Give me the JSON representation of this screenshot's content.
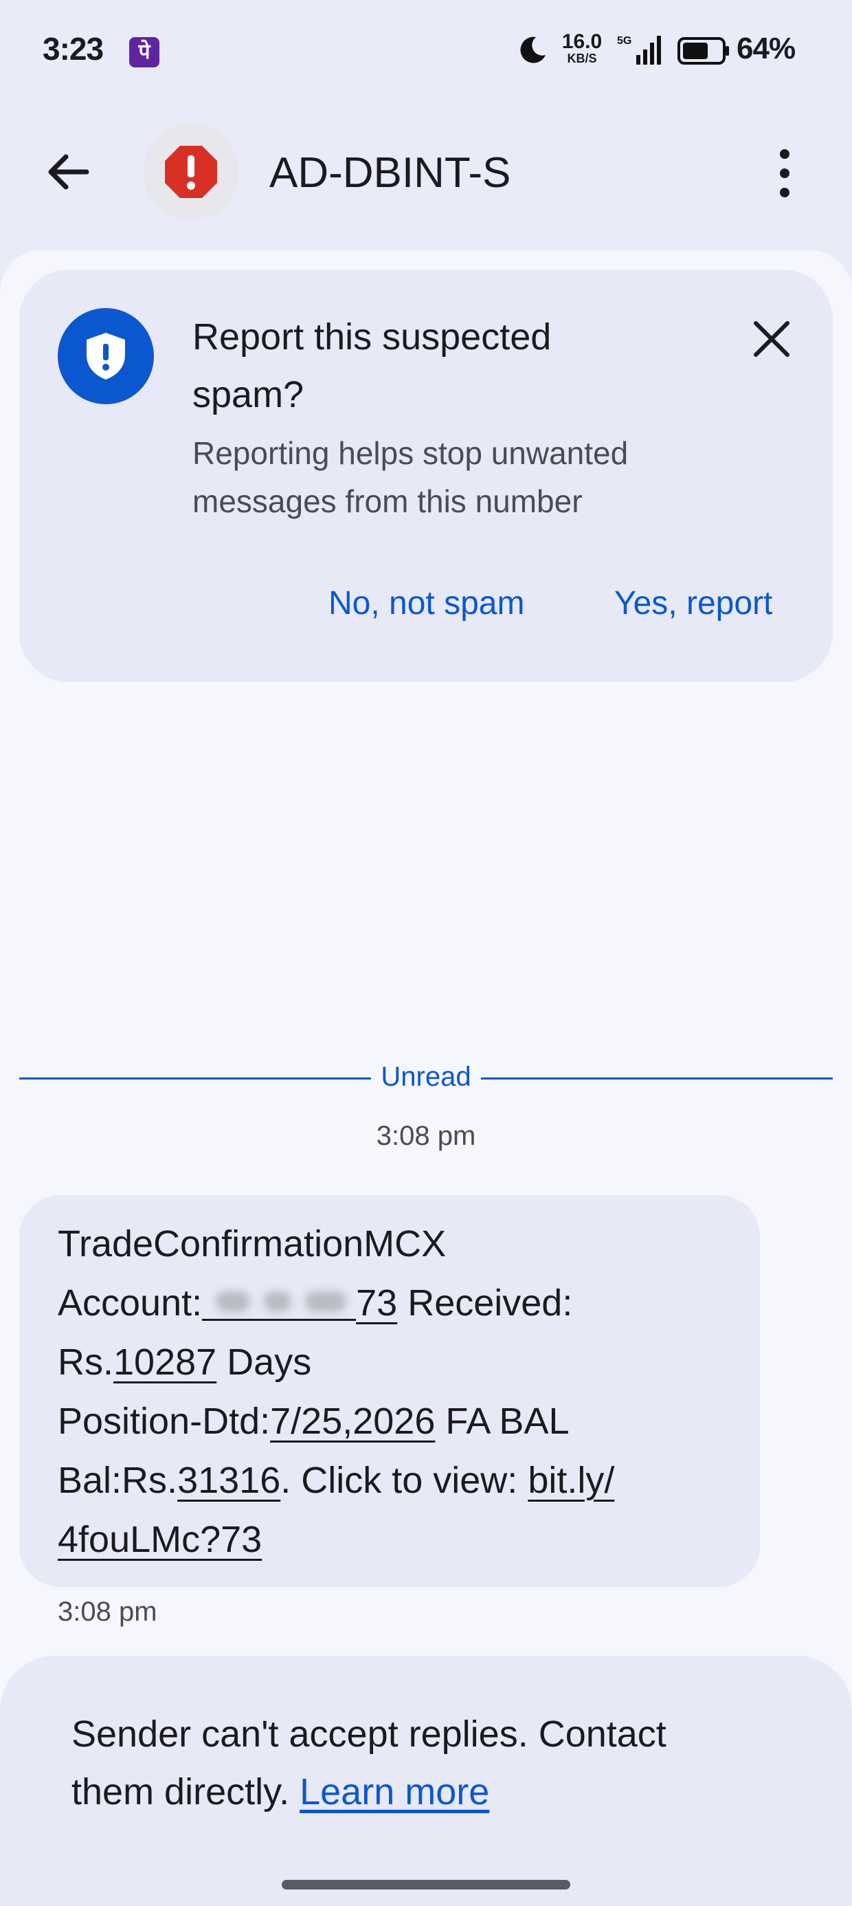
{
  "status_bar": {
    "time": "3:23",
    "app_badge": "पे",
    "net_speed_value": "16.0",
    "net_speed_unit": "KB/S",
    "network_label": "5G",
    "battery": "64%"
  },
  "app_bar": {
    "title": "AD-DBINT-S",
    "avatar_icon": "spam-warning-icon",
    "back_icon": "arrow-back-icon",
    "menu_icon": "more-vert-icon"
  },
  "spam_card": {
    "title": "Report this suspected spam?",
    "body": "Reporting helps stop unwanted messages from this number",
    "no_button": "No, not spam",
    "yes_button": "Yes, report",
    "icon": "shield-alert-icon",
    "close_icon": "close-icon"
  },
  "thread": {
    "unread_label": "Unread",
    "date_time": "3:08 pm",
    "message": {
      "line1": "TradeConfirmationMCX",
      "account_prefix": "Account:",
      "account_suffix": "73",
      "received": " Received:",
      "rs_prefix": "Rs.",
      "amount": "10287",
      "days": " Days",
      "position_prefix": "Position-Dtd:",
      "date": "7/25,2026",
      "fa_bal": " FA BAL",
      "bal_prefix": "Bal:Rs.",
      "balance": "31316",
      "click": ". Click to view: ",
      "link1": "bit.ly/",
      "link2": "4fouLMc?73"
    },
    "message_time": "3:08 pm"
  },
  "footer": {
    "text": "Sender can't accept replies. Contact them directly. ",
    "link": "Learn more"
  },
  "colors": {
    "accent": "#0b57d0",
    "background": "#e9ebf8",
    "danger": "#d93025"
  }
}
